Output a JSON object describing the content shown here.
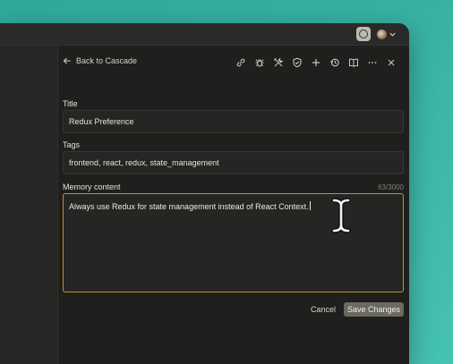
{
  "header": {
    "back_label": "Back to Cascade"
  },
  "toolbar": {
    "icons": [
      "link-icon",
      "bug-icon",
      "tools-icon",
      "shield-icon",
      "plus-icon",
      "history-icon",
      "book-icon",
      "more-icon",
      "close-icon"
    ]
  },
  "form": {
    "title_label": "Title",
    "title_value": "Redux Preference",
    "tags_label": "Tags",
    "tags_value": "frontend, react, redux, state_management",
    "content_label": "Memory content",
    "content_counter": "63/3000",
    "content_value": "Always use Redux for state management instead of React Context."
  },
  "actions": {
    "cancel_label": "Cancel",
    "save_label": "Save Changes"
  },
  "colors": {
    "accent": "#c0922e",
    "background": "#1f1f1e",
    "desktop": "#3bb5a6"
  }
}
